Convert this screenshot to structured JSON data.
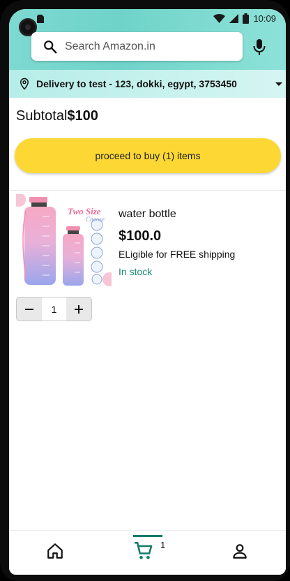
{
  "status_bar": {
    "time": "10:09"
  },
  "search": {
    "placeholder": "Search Amazon.in"
  },
  "delivery": {
    "text": "Delivery to test - 123, dokki, egypt, 3753450"
  },
  "subtotal": {
    "label": "Subtotal",
    "amount": "$100"
  },
  "buy_button": {
    "label": "proceed to buy (1) items"
  },
  "product": {
    "title": "water bottle",
    "price": "$100.0",
    "shipping": "ELigible for FREE shipping",
    "stock": "In stock",
    "image_text": "Two Size",
    "image_subtext": "Choose",
    "quantity": "1"
  },
  "bottom_nav": {
    "cart_count": "1"
  },
  "colors": {
    "header_teal": "#6fd3c9",
    "delivery_bg": "#c9f2ee",
    "buy_yellow": "#fdd835",
    "in_stock_green": "#1b8a73",
    "active_nav": "#137c6b"
  },
  "icons": {
    "search": "search-icon",
    "mic": "mic-icon",
    "location": "location-pin-icon",
    "dropdown": "chevron-down-icon",
    "minus": "minus-icon",
    "plus": "plus-icon",
    "home": "home-icon",
    "cart": "cart-icon",
    "account": "person-icon"
  }
}
